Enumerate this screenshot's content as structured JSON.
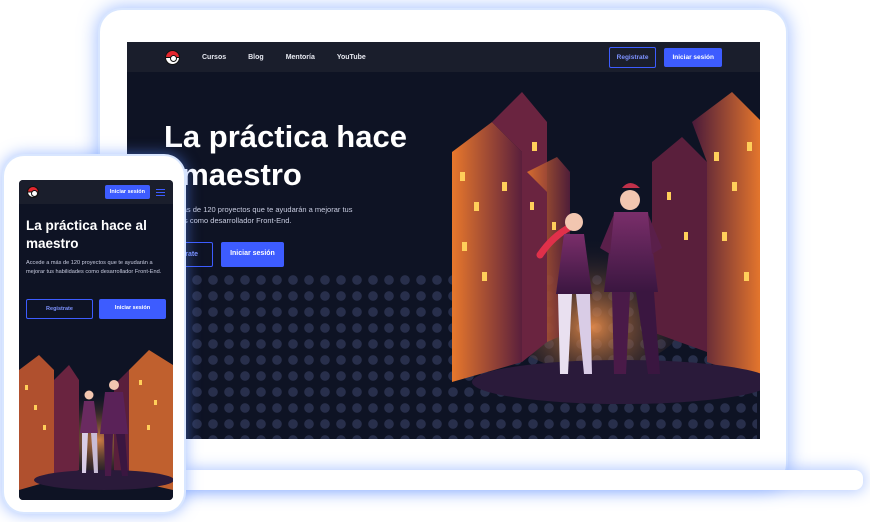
{
  "desktop": {
    "nav": {
      "links": [
        "Cursos",
        "Blog",
        "Mentoría",
        "YouTube"
      ],
      "register": "Registrate",
      "login": "Iniciar sesión"
    },
    "hero": {
      "title_line1": "La práctica hace",
      "title_line2": "l maestro",
      "desc_line1": "e a más de 120 proyectos que te ayudarán a mejorar tus",
      "desc_line2": "lidades como desarrollador Front-End.",
      "btn_register": "átrate",
      "btn_login": "Iniciar sesión"
    }
  },
  "mobile": {
    "nav": {
      "login": "Iniciar sesión"
    },
    "hero": {
      "title": "La práctica hace al maestro",
      "desc": "Accede a más de 120 proyectos que te ayudarán a mejorar tus habilidades como desarrollador Front-End.",
      "btn_register": "Registrate",
      "btn_login": "Iniciar sesión"
    }
  },
  "colors": {
    "accent": "#3d5cff",
    "background": "#0e1324",
    "navbar": "#1a1e2c",
    "glow": "#5a8cff"
  },
  "icons": [
    "pokeball-logo-icon",
    "hamburger-menu-icon"
  ]
}
